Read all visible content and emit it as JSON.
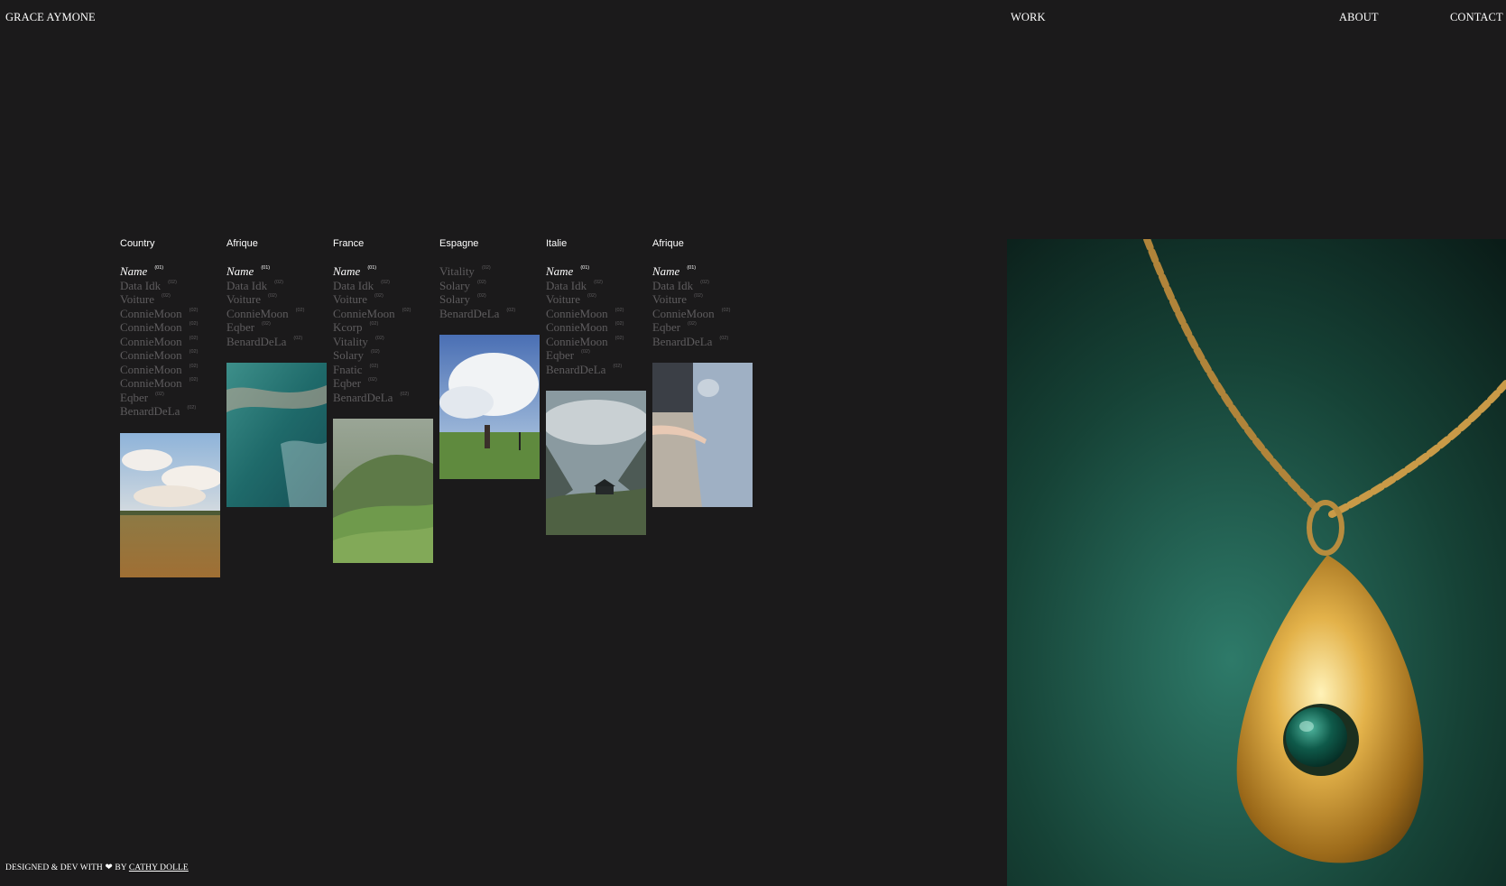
{
  "header": {
    "logo": "GRACE AYMONE",
    "nav": {
      "work": "WORK",
      "about": "ABOUT",
      "contact": "CONTACT"
    }
  },
  "columns": [
    {
      "heading": "Country",
      "items": [
        {
          "label": "Name",
          "count": "(01)",
          "active": true
        },
        {
          "label": "Data Idk",
          "count": "(02)"
        },
        {
          "label": "Voiture",
          "count": "(02)"
        },
        {
          "label": "ConnieMoon",
          "count": "(02)"
        },
        {
          "label": "ConnieMoon",
          "count": "(02)"
        },
        {
          "label": "ConnieMoon",
          "count": "(02)"
        },
        {
          "label": "ConnieMoon",
          "count": "(02)"
        },
        {
          "label": "ConnieMoon",
          "count": "(02)"
        },
        {
          "label": "ConnieMoon",
          "count": "(02)"
        },
        {
          "label": "Eqber",
          "count": "(02)"
        },
        {
          "label": "BenardDeLa",
          "count": "(02)"
        }
      ],
      "thumbnail": "field-under-clouds"
    },
    {
      "heading": "Afrique",
      "items": [
        {
          "label": "Name",
          "count": "(01)",
          "active": true
        },
        {
          "label": "Data Idk",
          "count": "(02)"
        },
        {
          "label": "Voiture",
          "count": "(02)"
        },
        {
          "label": "ConnieMoon",
          "count": "(02)"
        },
        {
          "label": "Eqber",
          "count": "(02)"
        },
        {
          "label": "BenardDeLa",
          "count": "(02)"
        }
      ],
      "thumbnail": "ocean-wave"
    },
    {
      "heading": "France",
      "items": [
        {
          "label": "Name",
          "count": "(01)",
          "active": true
        },
        {
          "label": "Data Idk",
          "count": "(02)"
        },
        {
          "label": "Voiture",
          "count": "(02)"
        },
        {
          "label": "ConnieMoon",
          "count": "(02)"
        },
        {
          "label": "Kcorp",
          "count": "(02)"
        },
        {
          "label": "Vitality",
          "count": "(02)"
        },
        {
          "label": "Solary",
          "count": "(02)"
        },
        {
          "label": "Fnatic",
          "count": "(02)"
        },
        {
          "label": "Eqber",
          "count": "(02)"
        },
        {
          "label": "BenardDeLa",
          "count": "(02)"
        }
      ],
      "thumbnail": "misty-green-hills"
    },
    {
      "heading": "Espagne",
      "items": [
        {
          "label": "Vitality",
          "count": "(02)"
        },
        {
          "label": "Solary",
          "count": "(02)"
        },
        {
          "label": "Solary",
          "count": "(02)"
        },
        {
          "label": "BenardDeLa",
          "count": "(02)"
        }
      ],
      "thumbnail": "photographer-in-meadow"
    },
    {
      "heading": "Italie",
      "items": [
        {
          "label": "Name",
          "count": "(01)",
          "active": true
        },
        {
          "label": "Data Idk",
          "count": "(02)"
        },
        {
          "label": "Voiture",
          "count": "(02)"
        },
        {
          "label": "ConnieMoon",
          "count": "(02)"
        },
        {
          "label": "ConnieMoon",
          "count": "(02)"
        },
        {
          "label": "ConnieMoon",
          "count": "(02)"
        },
        {
          "label": "Eqber",
          "count": "(02)"
        },
        {
          "label": "BenardDeLa",
          "count": "(02)"
        }
      ],
      "thumbnail": "cabin-in-mountain-valley"
    },
    {
      "heading": "Afrique",
      "items": [
        {
          "label": "Name",
          "count": "(01)",
          "active": true
        },
        {
          "label": "Data Idk",
          "count": "(02)"
        },
        {
          "label": "Voiture",
          "count": "(02)"
        },
        {
          "label": "ConnieMoon",
          "count": "(02)"
        },
        {
          "label": "Eqber",
          "count": "(02)"
        },
        {
          "label": "BenardDeLa",
          "count": "(02)"
        }
      ],
      "thumbnail": "hand-out-of-car-window"
    }
  ],
  "hero": {
    "image": "gold-pendant-necklace"
  },
  "footer": {
    "text_before": "DESIGNED & DEV WITH",
    "heart": "❤",
    "text_by": "BY",
    "credit_link": "CATHY DOLLE"
  },
  "colors": {
    "background": "#1b1a1b",
    "text": "#ffffff",
    "muted": "#5e5c5e"
  }
}
